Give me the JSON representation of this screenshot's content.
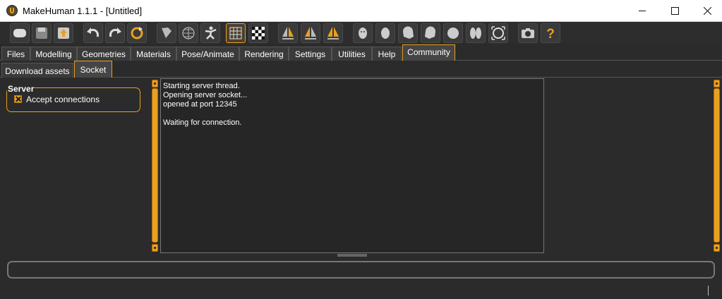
{
  "window": {
    "title": "MakeHuman 1.1.1 - [Untitled]"
  },
  "toolbar": {
    "buttons": [
      {
        "name": "undo-icon"
      },
      {
        "name": "redo-icon"
      },
      {
        "name": "reset-icon"
      }
    ]
  },
  "tabs": [
    {
      "label": "Files"
    },
    {
      "label": "Modelling"
    },
    {
      "label": "Geometries"
    },
    {
      "label": "Materials"
    },
    {
      "label": "Pose/Animate"
    },
    {
      "label": "Rendering"
    },
    {
      "label": "Settings"
    },
    {
      "label": "Utilities"
    },
    {
      "label": "Help"
    },
    {
      "label": "Community"
    }
  ],
  "active_tab": "Community",
  "subtabs": [
    {
      "label": "Download assets"
    },
    {
      "label": "Socket"
    }
  ],
  "active_subtab": "Socket",
  "server": {
    "title": "Server",
    "accept_label": "Accept connections",
    "accept_checked": true
  },
  "console": {
    "lines": [
      "Starting server thread.",
      "Opening server socket...",
      "opened at port 12345",
      "",
      "Waiting for connection."
    ]
  },
  "colors": {
    "accent": "#e8a020",
    "background": "#2b2b2b",
    "console_bg": "#262626"
  }
}
